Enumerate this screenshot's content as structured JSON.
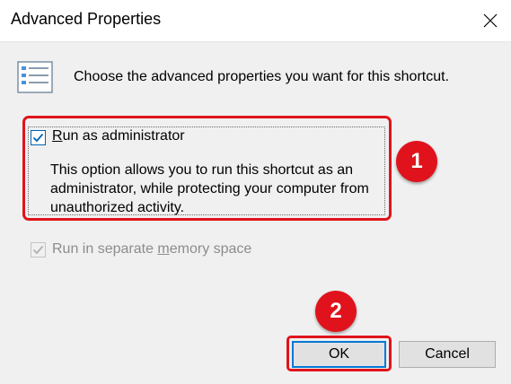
{
  "window": {
    "title": "Advanced Properties",
    "close_icon": "close-icon"
  },
  "header": {
    "icon": "properties-list-icon",
    "text": "Choose the advanced properties you want for this shortcut."
  },
  "options": {
    "run_as_admin": {
      "label_prefix": "",
      "label_accel": "R",
      "label_rest": "un as administrator",
      "checked": true,
      "description": "This option allows you to run this shortcut as an administrator, while protecting your computer from unauthorized activity."
    },
    "separate_memory": {
      "label_prefix": "Run in separate ",
      "label_accel": "m",
      "label_rest": "emory space",
      "checked": true,
      "disabled": true
    }
  },
  "buttons": {
    "ok": "OK",
    "cancel": "Cancel"
  },
  "annotations": {
    "badge1": "1",
    "badge2": "2",
    "highlight_color": "#e0131c"
  },
  "colors": {
    "accent": "#0078d7",
    "window_bg": "#f0f0f0",
    "titlebar_bg": "#ffffff"
  }
}
